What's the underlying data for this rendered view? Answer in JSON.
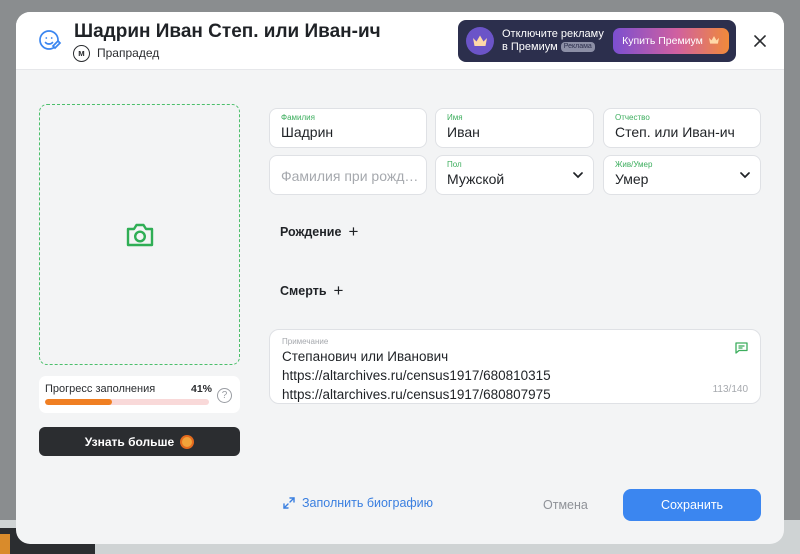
{
  "header": {
    "title": "Шадрин Иван Степ. или Иван-ич",
    "gender_badge": "м",
    "relation": "Прапрадед"
  },
  "promo": {
    "text_line1": "Отключите рекламу",
    "text_line2": "в Премиум",
    "ad_tag": "Реклама",
    "buy_label": "Купить Премиум"
  },
  "progress": {
    "label": "Прогресс заполнения",
    "percent_text": "41%",
    "percent_value": 0.41,
    "help": "?"
  },
  "learn_more": {
    "label": "Узнать больше"
  },
  "fields": {
    "surname": {
      "label": "Фамилия",
      "value": "Шадрин"
    },
    "name": {
      "label": "Имя",
      "value": "Иван"
    },
    "patronymic": {
      "label": "Отчество",
      "value": "Степ. или Иван-ич"
    },
    "birth_surname": {
      "placeholder": "Фамилия при рождении"
    },
    "gender": {
      "label": "Пол",
      "value": "Мужской"
    },
    "alive": {
      "label": "Жив/Умер",
      "value": "Умер"
    }
  },
  "sections": {
    "birth": "Рождение",
    "death": "Смерть",
    "plus": "+"
  },
  "note": {
    "label": "Примечание",
    "lines": [
      "Степанович или Иванович",
      "https://altarchives.ru/census1917/680810315",
      "https://altarchives.ru/census1917/680807975"
    ],
    "counter": "113/140"
  },
  "footer": {
    "fill_bio": "Заполнить биографию",
    "cancel": "Отмена",
    "save": "Сохранить"
  },
  "colors": {
    "accent_green": "#3dae5e",
    "primary_blue": "#3b86f0",
    "progress_orange": "#f07f22"
  },
  "icons": {
    "person": "person-edit-icon",
    "camera": "camera-icon",
    "close": "close-icon",
    "chevron": "chevron-down-icon",
    "note": "comment-icon",
    "expand": "expand-arrows-icon",
    "crown": "crown-icon",
    "coin": "coin-icon"
  }
}
